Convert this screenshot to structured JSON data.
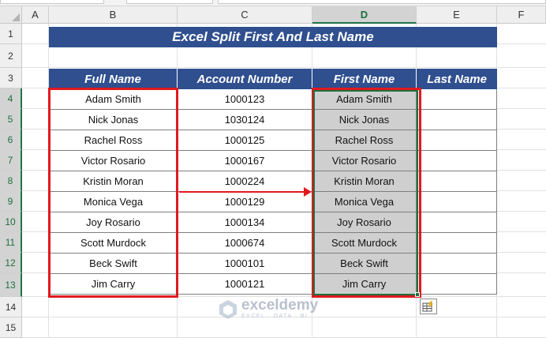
{
  "columns": [
    "A",
    "B",
    "C",
    "D",
    "E",
    "F"
  ],
  "selected_column": "D",
  "rows": [
    "1",
    "2",
    "3",
    "4",
    "5",
    "6",
    "7",
    "8",
    "9",
    "10",
    "11",
    "12",
    "13",
    "14",
    "15"
  ],
  "title": "Excel Split First And Last Name",
  "headers": {
    "full_name": "Full Name",
    "account_number": "Account Number",
    "first_name": "First Name",
    "last_name": "Last Name"
  },
  "records": [
    {
      "full_name": "Adam Smith",
      "account": "1000123",
      "first_name": "Adam Smith",
      "last_name": ""
    },
    {
      "full_name": "Nick Jonas",
      "account": "1030124",
      "first_name": "Nick Jonas",
      "last_name": ""
    },
    {
      "full_name": "Rachel Ross",
      "account": "1000125",
      "first_name": "Rachel Ross",
      "last_name": ""
    },
    {
      "full_name": "Victor Rosario",
      "account": "1000167",
      "first_name": "Victor Rosario",
      "last_name": ""
    },
    {
      "full_name": "Kristin Moran",
      "account": "1000224",
      "first_name": "Kristin Moran",
      "last_name": ""
    },
    {
      "full_name": "Monica Vega",
      "account": "1000129",
      "first_name": "Monica Vega",
      "last_name": ""
    },
    {
      "full_name": "Joy Rosario",
      "account": "1000134",
      "first_name": "Joy Rosario",
      "last_name": ""
    },
    {
      "full_name": "Scott Murdock",
      "account": "1000674",
      "first_name": "Scott Murdock",
      "last_name": ""
    },
    {
      "full_name": "Beck Swift",
      "account": "1000101",
      "first_name": "Beck Swift",
      "last_name": ""
    },
    {
      "full_name": "Jim Carry",
      "account": "1000121",
      "first_name": "Jim Carry",
      "last_name": ""
    }
  ],
  "watermark": {
    "name": "exceldemy",
    "tagline": "EXCEL · DATA · BI"
  },
  "colors": {
    "header_bg": "#2f4f8f",
    "highlight_red": "#e0191f",
    "selection_green": "#1e6f3e",
    "filled_gray": "#cfcfcf"
  },
  "icons": {
    "flash_fill_options": "flash-fill-icon",
    "logo": "exceldemy-logo-icon"
  }
}
